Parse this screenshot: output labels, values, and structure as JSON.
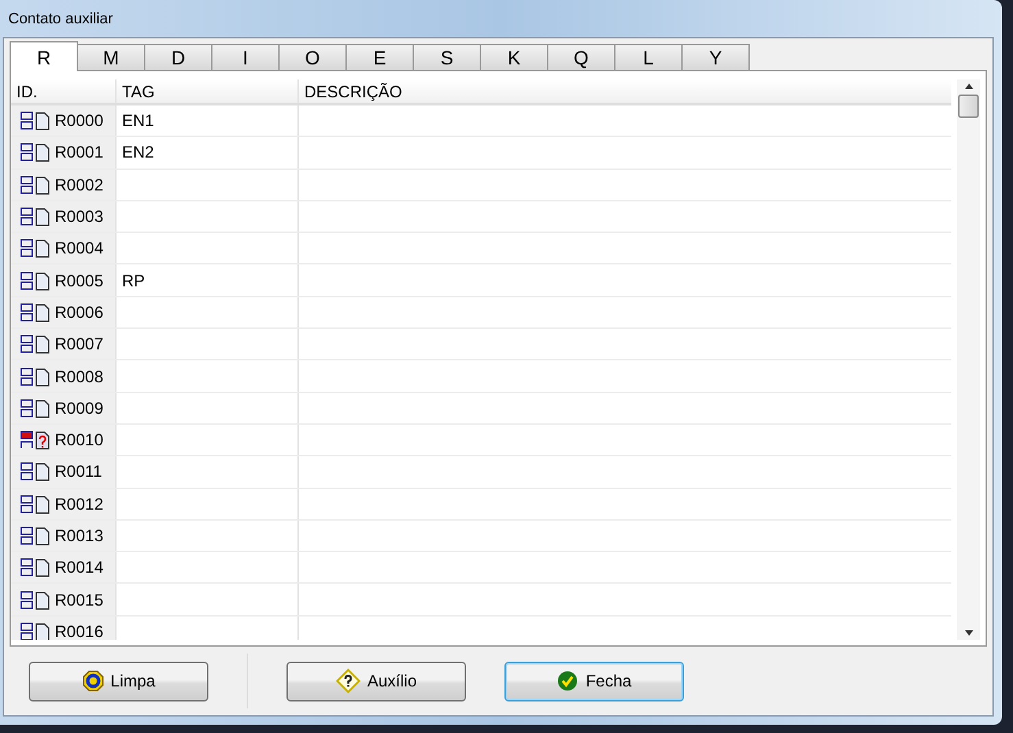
{
  "window": {
    "title": "Contato auxiliar"
  },
  "tabs": [
    {
      "label": "R",
      "selected": true
    },
    {
      "label": "M",
      "selected": false
    },
    {
      "label": "D",
      "selected": false
    },
    {
      "label": "I",
      "selected": false
    },
    {
      "label": "O",
      "selected": false
    },
    {
      "label": "E",
      "selected": false
    },
    {
      "label": "S",
      "selected": false
    },
    {
      "label": "K",
      "selected": false
    },
    {
      "label": "Q",
      "selected": false
    },
    {
      "label": "L",
      "selected": false
    },
    {
      "label": "Y",
      "selected": false
    }
  ],
  "table": {
    "columns": [
      "ID.",
      "TAG",
      "DESCRIÇÃO"
    ],
    "rows": [
      {
        "kind": "normal",
        "id": "R0000",
        "tag": "EN1"
      },
      {
        "kind": "normal",
        "id": "R0001",
        "tag": "EN2"
      },
      {
        "kind": "normal",
        "id": "R0002"
      },
      {
        "kind": "normal",
        "id": "R0003"
      },
      {
        "kind": "normal",
        "id": "R0004"
      },
      {
        "kind": "normal",
        "id": "R0005",
        "tag": "RP"
      },
      {
        "kind": "normal",
        "id": "R0006"
      },
      {
        "kind": "normal",
        "id": "R0007"
      },
      {
        "kind": "normal",
        "id": "R0008"
      },
      {
        "kind": "normal",
        "id": "R0009"
      },
      {
        "kind": "alert",
        "id": "R0010"
      },
      {
        "kind": "normal",
        "id": "R0011"
      },
      {
        "kind": "normal",
        "id": "R0012"
      },
      {
        "kind": "normal",
        "id": "R0013"
      },
      {
        "kind": "normal",
        "id": "R0014"
      },
      {
        "kind": "normal",
        "id": "R0015"
      },
      {
        "kind": "normal",
        "id": "R0016"
      }
    ]
  },
  "buttons": [
    {
      "kind": "clear",
      "label": "Limpa",
      "focused": false
    },
    {
      "kind": "help",
      "label": "Auxílio",
      "focused": false
    },
    {
      "kind": "close",
      "label": "Fecha",
      "focused": true
    }
  ]
}
